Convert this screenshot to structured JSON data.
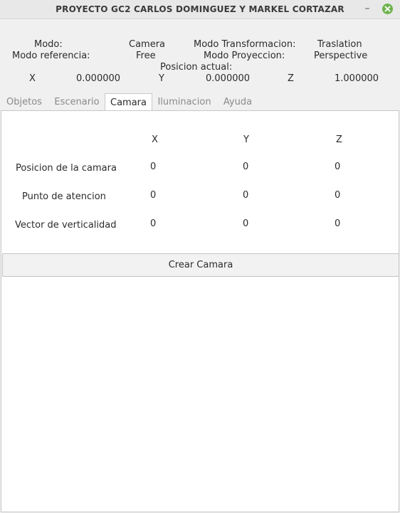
{
  "window": {
    "title": "PROYECTO GC2 CARLOS DOMINGUEZ Y MARKEL CORTAZAR",
    "minimize_label": "–"
  },
  "info": {
    "modo_label": "Modo:",
    "modo_value": "Camera",
    "modo_transformacion_label": "Modo Transformacion:",
    "modo_transformacion_value": "Traslation",
    "modo_referencia_label": "Modo referencia:",
    "modo_referencia_value": "Free",
    "modo_proyeccion_label": "Modo Proyeccion:",
    "modo_proyeccion_value": "Perspective",
    "posicion_actual_label": "Posicion actual:",
    "x_label": "X",
    "x_value": "0.000000",
    "y_label": "Y",
    "y_value": "0.000000",
    "z_label": "Z",
    "z_value": "1.000000"
  },
  "tabs": [
    "Objetos",
    "Escenario",
    "Camara",
    "Iluminacion",
    "Ayuda"
  ],
  "active_tab": "Camara",
  "camara": {
    "headers": [
      "X",
      "Y",
      "Z"
    ],
    "rows": [
      {
        "label": "Posicion de la camara",
        "x": "0",
        "y": "0",
        "z": "0"
      },
      {
        "label": "Punto de atencion",
        "x": "0",
        "y": "0",
        "z": "0"
      },
      {
        "label": "Vector de verticalidad",
        "x": "0",
        "y": "0",
        "z": "0"
      }
    ],
    "button_label": "Crear Camara"
  },
  "colors": {
    "close_button": "#6fb34f",
    "panel_background": "#ffffff",
    "window_background": "#f0f0f0"
  }
}
